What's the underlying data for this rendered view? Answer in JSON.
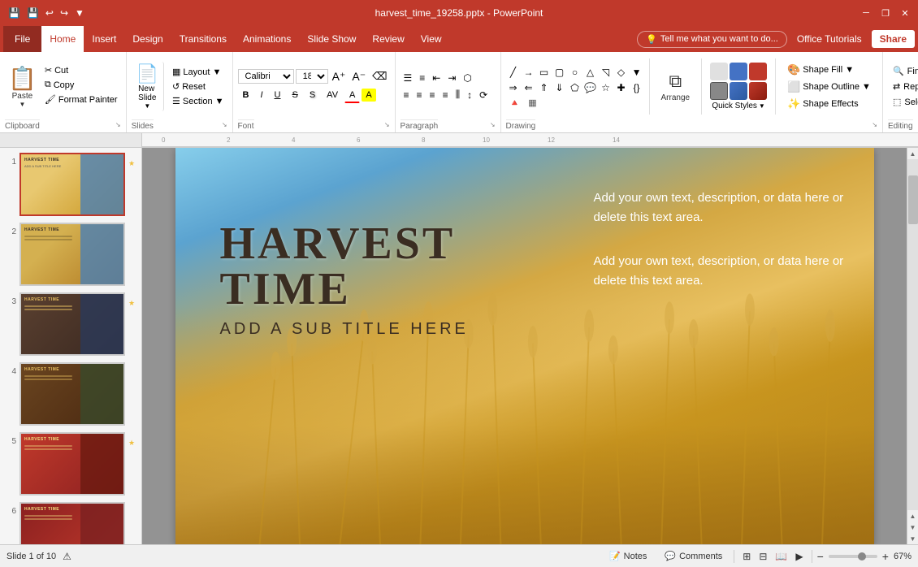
{
  "titlebar": {
    "filename": "harvest_time_19258.pptx - PowerPoint",
    "quickaccess": [
      "save",
      "undo",
      "redo",
      "customize"
    ],
    "winbtns": [
      "minimize",
      "restore",
      "close"
    ]
  },
  "menubar": {
    "file_label": "File",
    "tabs": [
      "Home",
      "Insert",
      "Design",
      "Transitions",
      "Animations",
      "Slide Show",
      "Review",
      "View"
    ],
    "active_tab": "Home",
    "tellme_placeholder": "Tell me what you want to do...",
    "office_tutorials": "Office Tutorials",
    "share": "Share"
  },
  "ribbon": {
    "groups": {
      "clipboard": {
        "label": "Clipboard",
        "paste": "Paste",
        "cut": "Cut",
        "copy": "Copy",
        "format_painter": "Format Painter"
      },
      "slides": {
        "label": "Slides",
        "new_slide": "New\nSlide",
        "layout": "Layout",
        "reset": "Reset",
        "section": "Section"
      },
      "font": {
        "label": "Font",
        "font_name": "Calibri",
        "font_size": "18",
        "bold": "B",
        "italic": "I",
        "underline": "U",
        "strikethrough": "S",
        "shadow": "S"
      },
      "paragraph": {
        "label": "Paragraph"
      },
      "drawing": {
        "label": "Drawing",
        "arrange": "Arrange",
        "quick_styles": "Quick Styles",
        "quick_styles_arrow": "▼",
        "shape_fill": "Shape Fill ▼",
        "shape_outline": "Shape Outline",
        "shape_effects": "Shape Effects"
      },
      "editing": {
        "label": "Editing",
        "find": "Find",
        "replace": "Replace",
        "select": "Select ▼"
      }
    }
  },
  "slides_panel": {
    "slides": [
      {
        "num": "1",
        "starred": true,
        "bg": "t1",
        "title": "HARVEST TIME"
      },
      {
        "num": "2",
        "starred": false,
        "bg": "t2",
        "title": "HARVEST TIME"
      },
      {
        "num": "3",
        "starred": true,
        "bg": "t3",
        "title": "HARVEST TIME"
      },
      {
        "num": "4",
        "starred": false,
        "bg": "t4",
        "title": "HARVEST TIME"
      },
      {
        "num": "5",
        "starred": true,
        "bg": "t5",
        "title": "HARVEST TIME"
      },
      {
        "num": "6",
        "starred": false,
        "bg": "t6",
        "title": "HARVEST TIME"
      }
    ]
  },
  "slide": {
    "title": "HARVEST TIME",
    "subtitle": "ADD A SUB TITLE HERE",
    "text1": "Add your own text, description, or data here or delete this text area.",
    "text2": "Add your own text, description, or data here or delete this text area."
  },
  "statusbar": {
    "slide_info": "Slide 1 of 10",
    "notes": "Notes",
    "comments": "Comments",
    "zoom": "67%"
  }
}
